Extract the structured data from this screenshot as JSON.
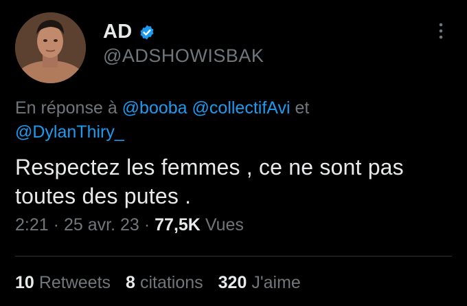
{
  "author": {
    "display_name": "AD",
    "handle": "@ADSHOWISBAK",
    "verified_icon": "verified-badge-icon",
    "avatar_icon": "avatar-photo"
  },
  "reply": {
    "prefix": "En réponse à ",
    "mention_1": "@booba",
    "mention_2": "@collectifAvi",
    "conjunction": " et ",
    "mention_3": "@DylanThiry_"
  },
  "tweet": {
    "line_1": "Respectez les femmes , ce ne sont pas",
    "line_2": "toutes des putes ."
  },
  "meta": {
    "time": "2:21",
    "date": "25 avr. 23",
    "separator": "·",
    "views_count": "77,5K",
    "views_label": "Vues"
  },
  "stats": {
    "retweets_count": "10",
    "retweets_label": "Retweets",
    "quotes_count": "8",
    "quotes_label": "citations",
    "likes_count": "320",
    "likes_label": "J'aime"
  },
  "colors": {
    "background": "#000000",
    "text": "#e7e9ea",
    "muted": "#71767b",
    "accent": "#1d9bf0",
    "divider": "#2f3336"
  }
}
